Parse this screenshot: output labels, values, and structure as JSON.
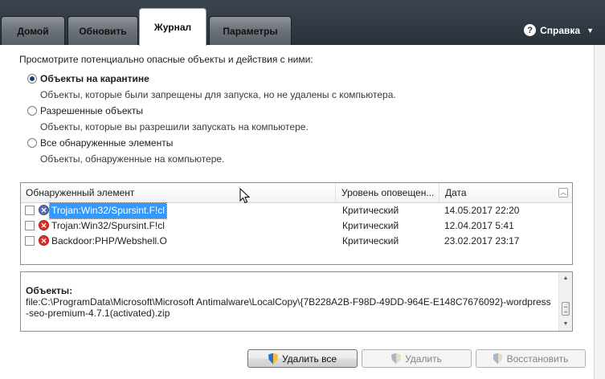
{
  "tabs": [
    {
      "label": "Домой"
    },
    {
      "label": "Обновить"
    },
    {
      "label": "Журнал"
    },
    {
      "label": "Параметры"
    }
  ],
  "help": {
    "label": "Справка"
  },
  "intro": "Просмотрите потенциально опасные объекты и действия с ними:",
  "options": [
    {
      "label": "Объекты на карантине",
      "desc": "Объекты, которые были запрещены для запуска, но не удалены с компьютера.",
      "checked": true
    },
    {
      "label": "Разрешенные объекты",
      "desc": "Объекты, которые вы разрешили запускать на компьютере.",
      "checked": false
    },
    {
      "label": "Все обнаруженные элементы",
      "desc": "Объекты, обнаруженные на компьютере.",
      "checked": false
    }
  ],
  "list": {
    "columns": [
      "Обнаруженный элемент",
      "Уровень оповещен...",
      "Дата"
    ],
    "rows": [
      {
        "name": "Trojan:Win32/Spursint.F!cl",
        "level": "Критический",
        "date": "14.05.2017 22:20",
        "selected": true
      },
      {
        "name": "Trojan:Win32/Spursint.F!cl",
        "level": "Критический",
        "date": "12.04.2017 5:41",
        "selected": false
      },
      {
        "name": "Backdoor:PHP/Webshell.O",
        "level": "Критический",
        "date": "23.02.2017 23:17",
        "selected": false
      }
    ]
  },
  "details": {
    "label": "Объекты:",
    "text": "file:C:\\ProgramData\\Microsoft\\Microsoft Antimalware\\LocalCopy\\{7B228A2B-F98D-49DD-964E-E148C7676092}-wordpress-seo-premium-4.7.1(activated).zip"
  },
  "buttons": {
    "delete_all": "Удалить все",
    "delete": "Удалить",
    "restore": "Восстановить"
  },
  "icons": {
    "help": "question-circle-icon",
    "threat": "x-circle-icon",
    "shield": "uac-shield-icon"
  }
}
